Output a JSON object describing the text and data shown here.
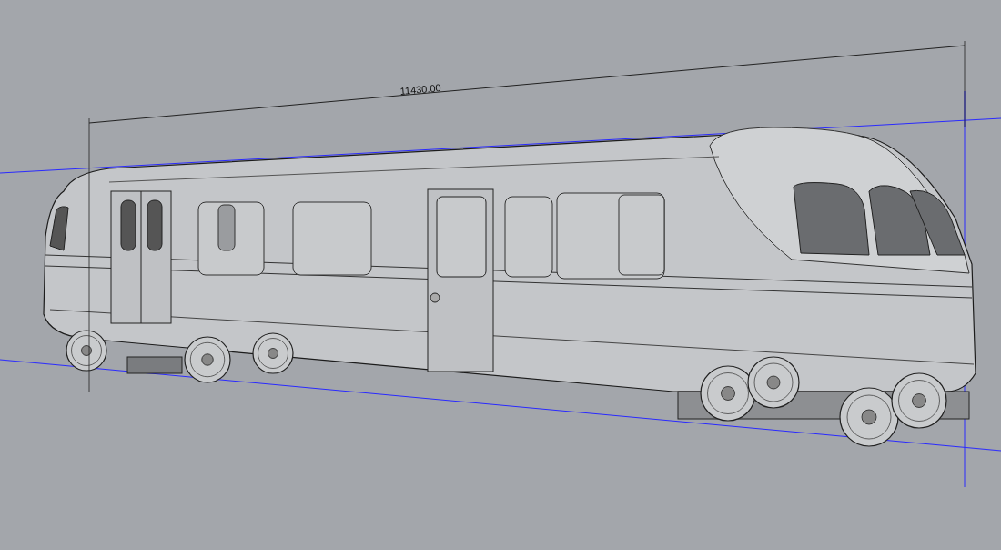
{
  "viewport": {
    "dimension": {
      "label": "11430.00"
    }
  }
}
